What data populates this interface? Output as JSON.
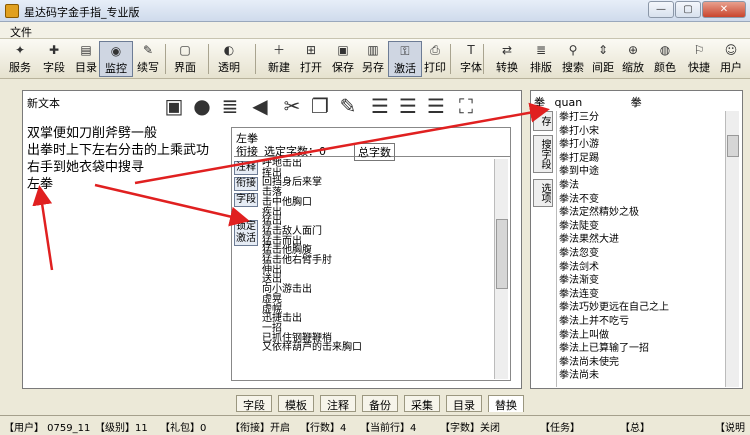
{
  "window": {
    "title": "星达码字金手指_专业版",
    "controls": [
      "—",
      "▢",
      "✕"
    ]
  },
  "menu": {
    "file": "文件"
  },
  "toolbar": [
    {
      "label": "服务",
      "icon": "service-icon"
    },
    {
      "label": "字段",
      "icon": "field-icon"
    },
    {
      "label": "目录",
      "icon": "catalog-icon"
    },
    {
      "label": "监控",
      "icon": "monitor-icon"
    },
    {
      "label": "续写",
      "icon": "continue-icon"
    },
    {
      "label": "界面",
      "icon": "interface-icon"
    },
    {
      "label": "透明",
      "icon": "transparent-icon"
    },
    {
      "label": "新建",
      "icon": "new-icon"
    },
    {
      "label": "打开",
      "icon": "open-icon"
    },
    {
      "label": "保存",
      "icon": "save-icon"
    },
    {
      "label": "另存",
      "icon": "saveas-icon"
    },
    {
      "label": "激活",
      "icon": "activate-icon"
    },
    {
      "label": "打印",
      "icon": "print-icon"
    },
    {
      "label": "字体",
      "icon": "font-icon"
    },
    {
      "label": "转换",
      "icon": "convert-icon"
    },
    {
      "label": "排版",
      "icon": "layout-icon"
    },
    {
      "label": "搜索",
      "icon": "search-icon"
    },
    {
      "label": "间距",
      "icon": "spacing-icon"
    },
    {
      "label": "缩放",
      "icon": "zoom-icon"
    },
    {
      "label": "颜色",
      "icon": "color-icon"
    },
    {
      "label": "快捷",
      "icon": "shortcut-icon"
    },
    {
      "label": "用户",
      "icon": "user-icon"
    }
  ],
  "editor": {
    "doc_name": "新文本",
    "lines": [
      "双掌便如刀削斧劈一般",
      "出拳时上下左右分击的上乘武功",
      "右手到她衣袋中搜寻",
      "左拳"
    ]
  },
  "popup": {
    "title": "左拳",
    "tabs": [
      "衔接",
      "选定字数：0",
      "总字数"
    ],
    "buttons": [
      "注释",
      "衔接",
      "字段",
      "锁定激活"
    ],
    "items": [
      "呼地击出",
      "挥出",
      "回挡身后来掌",
      "击落",
      "击中他胸口",
      "疾出",
      "猛出",
      "猛击敌人面门",
      "猛击而出",
      "猛击他胸腹",
      "猛击他右臂手肘",
      "伸出",
      "送出",
      "向小游击出",
      "虚晃",
      "虚幌",
      "迅捷击出",
      "一招",
      "已抓住钢鞭鞭梢",
      "又依样葫芦的击来胸口"
    ]
  },
  "right": {
    "header_left": "拳",
    "header_pinyin": "quan",
    "header_right": "拳",
    "vtabs": [
      "存",
      "搜字段",
      "选项"
    ],
    "items": [
      "拳打三分",
      "拳打小宋",
      "拳打小游",
      "拳打足踢",
      "拳到中途",
      "拳法",
      "拳法不变",
      "拳法定然精妙之极",
      "拳法陡变",
      "拳法果然大进",
      "拳法忽变",
      "拳法剑术",
      "拳法渐变",
      "拳法连变",
      "拳法巧妙更远在自己之上",
      "拳法上并不吃亏",
      "拳法上叫做",
      "拳法上已算输了一招",
      "拳法尚未使完",
      "拳法尚未"
    ]
  },
  "bottom_tabs": [
    "字段",
    "模板",
    "注释",
    "备份",
    "采集",
    "目录",
    "替换"
  ],
  "status": {
    "user": "【用户】 0759_11",
    "level": "【级别】11",
    "gift": "【礼包】0",
    "link": "【衔接】开启",
    "rows": "【行数】4",
    "current": "【当前行】4",
    "charcount": "【字数】关闭",
    "task": "【任务】",
    "total": "【总】",
    "explain": "【说明"
  }
}
